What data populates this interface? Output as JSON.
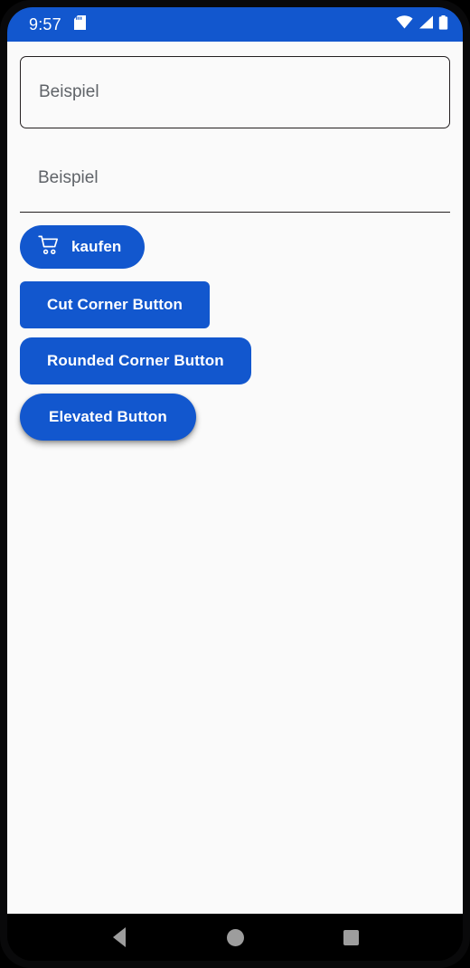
{
  "status_bar": {
    "clock": "9:57",
    "icons": {
      "sd_card": "sd-card-icon",
      "wifi": "wifi-icon",
      "signal": "cellular-signal-icon",
      "battery": "battery-icon"
    },
    "background_color": "#1257CE",
    "foreground_color": "#FFFFFF"
  },
  "fields": {
    "outlined": {
      "placeholder": "Beispiel",
      "value": ""
    },
    "underlined": {
      "placeholder": "Beispiel",
      "value": ""
    }
  },
  "buttons": {
    "buy": {
      "label": "kaufen",
      "icon": "shopping-cart-icon"
    },
    "cut_corner": {
      "label": "Cut Corner Button"
    },
    "rounded_corner": {
      "label": "Rounded Corner Button"
    },
    "elevated": {
      "label": "Elevated Button"
    },
    "accent_color": "#1257CE",
    "text_color": "#FFFFFF"
  },
  "navigation_bar": {
    "back": "back-triangle-icon",
    "home": "home-circle-icon",
    "recents": "recents-square-icon",
    "icon_color": "#9D9D9D",
    "background_color": "#000000"
  },
  "theme": {
    "page_background": "#FAFAFA",
    "frame_color": "#09090A",
    "divider_color": "#231F20"
  }
}
